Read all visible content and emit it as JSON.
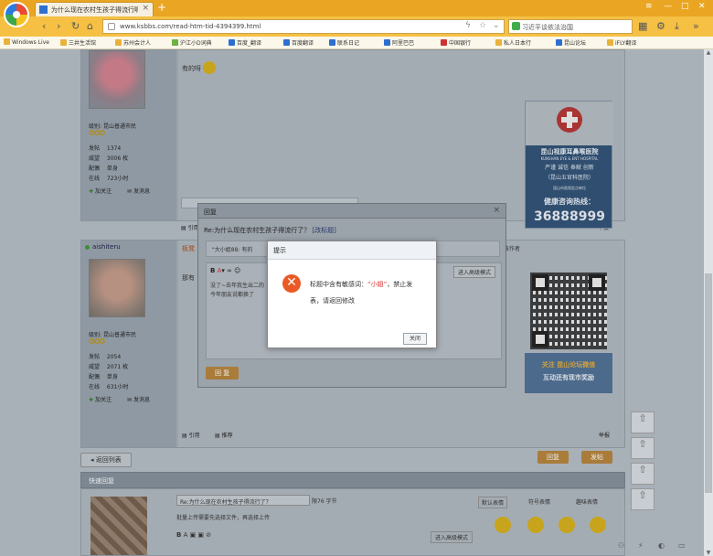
{
  "browser": {
    "tab_title": "为什么现在农村生孩子得流行啊",
    "url": "www.ksbbs.com/read-htm-tid-4394399.html",
    "search_text": "习近平谈依法治国",
    "bookmarks": [
      "Windows Live",
      "三井生活馆",
      "苏州会计人",
      "沪江小D词典",
      "百度_翻译",
      "百度翻译",
      "联系日记",
      "阿里巴巴",
      "中国银行",
      "私人日本行",
      "昆山论坛",
      "iFLY翻译"
    ]
  },
  "posts": {
    "first": {
      "text": "有的呀",
      "level": "昆山普通市民",
      "stats": [
        [
          "发帖",
          "1374"
        ],
        [
          "威望",
          "3006 枚"
        ],
        [
          "配偶",
          "单身"
        ],
        [
          "在线",
          "723小时"
        ]
      ],
      "follow": "加关注",
      "message": "发消息"
    },
    "second": {
      "username": "aishiteru",
      "reply_tag": "板凳",
      "text_partial": "那有",
      "level": "昆山普通市民",
      "stats": [
        [
          "发帖",
          "2054"
        ],
        [
          "威望",
          "2071 枚"
        ],
        [
          "配偶",
          "单身"
        ],
        [
          "在线",
          "631小时"
        ]
      ],
      "follow": "加关注",
      "message": "发消息",
      "header_right": "留言  只看该作者",
      "quote": "引用",
      "report": "举报",
      "share": "推荐"
    }
  },
  "ads": {
    "hospital_name": "昆山视康耳鼻喉医院",
    "hospital_en": "KUNSHAN EYE & ENT HOSPITAL",
    "slogan": "严谨 诚信 奉献 创新",
    "grade": "（昆山五官科医院）",
    "note": "昆山市医保定点单位",
    "hotline_label": "健康咨询热线：",
    "hotline": "36888999",
    "wechat_line1": "关注 昆山论坛微信",
    "wechat_line2": "互动还有现市奖励"
  },
  "reply_dialog": {
    "title": "回复",
    "subject": "Re:为什么现在农村生孩子得流行了？",
    "subject_link": "[改标题]",
    "quote_line": "\"大小姐88: 有的",
    "body": "没了~去年我生出二的\n今年朋友说都换了",
    "mode_button": "进入高级模式",
    "submit": "回 复"
  },
  "alert": {
    "title": "提示",
    "message_pre": "标题中含有敏感词：",
    "message_word": "“小姐”",
    "message_post": "，禁止发表，请返回修改",
    "close": "关闭"
  },
  "page_actions": {
    "back_list": "◂ 返回列表",
    "reply": "回复",
    "post": "发帖"
  },
  "quick_reply": {
    "title": "快速回复",
    "subject": "Re:为什么现在农村生孩子得流行了？",
    "count": "限76 字节",
    "hint": "批量上传需要先选择文件，再选择上传",
    "mode": "进入高级模式",
    "emoji_tabs": [
      "默认表情",
      "符号表情",
      "趣味表情"
    ]
  }
}
